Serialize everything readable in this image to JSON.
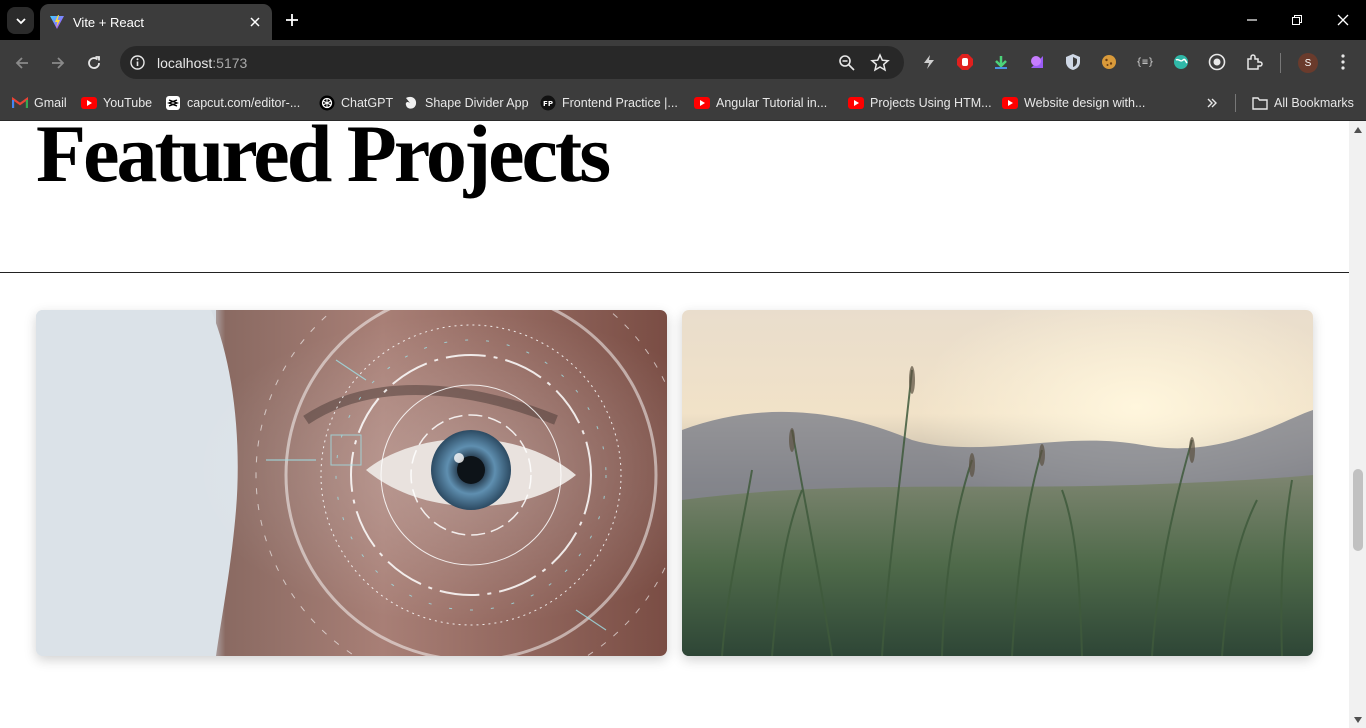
{
  "browser": {
    "tab": {
      "title": "Vite + React"
    },
    "omnibox": {
      "host": "localhost",
      "port": ":5173"
    },
    "profile": {
      "initial": "S"
    }
  },
  "bookmarks": [
    {
      "label": "Gmail",
      "icon": "gmail-icon"
    },
    {
      "label": "YouTube",
      "icon": "youtube-icon"
    },
    {
      "label": "capcut.com/editor-...",
      "icon": "capcut-icon"
    },
    {
      "label": "ChatGPT",
      "icon": "chatgpt-icon"
    },
    {
      "label": "Shape Divider App",
      "icon": "shape-divider-icon"
    },
    {
      "label": "Frontend Practice |...",
      "icon": "fp-icon"
    },
    {
      "label": "Angular Tutorial in...",
      "icon": "youtube-icon"
    },
    {
      "label": "Projects Using HTM...",
      "icon": "youtube-icon"
    },
    {
      "label": "Website design with...",
      "icon": "youtube-icon"
    }
  ],
  "all_bookmarks_label": "All Bookmarks",
  "page": {
    "title": "Featured Projects",
    "projects": [
      {
        "image": "futuristic eye scan"
      },
      {
        "image": "grass field at sunset"
      }
    ]
  },
  "colors": {
    "youtube_red": "#ff0000",
    "tab_bg": "#3c3c3c",
    "toolbar_bg": "#3c3c3c",
    "omnibox_bg": "#282828"
  }
}
